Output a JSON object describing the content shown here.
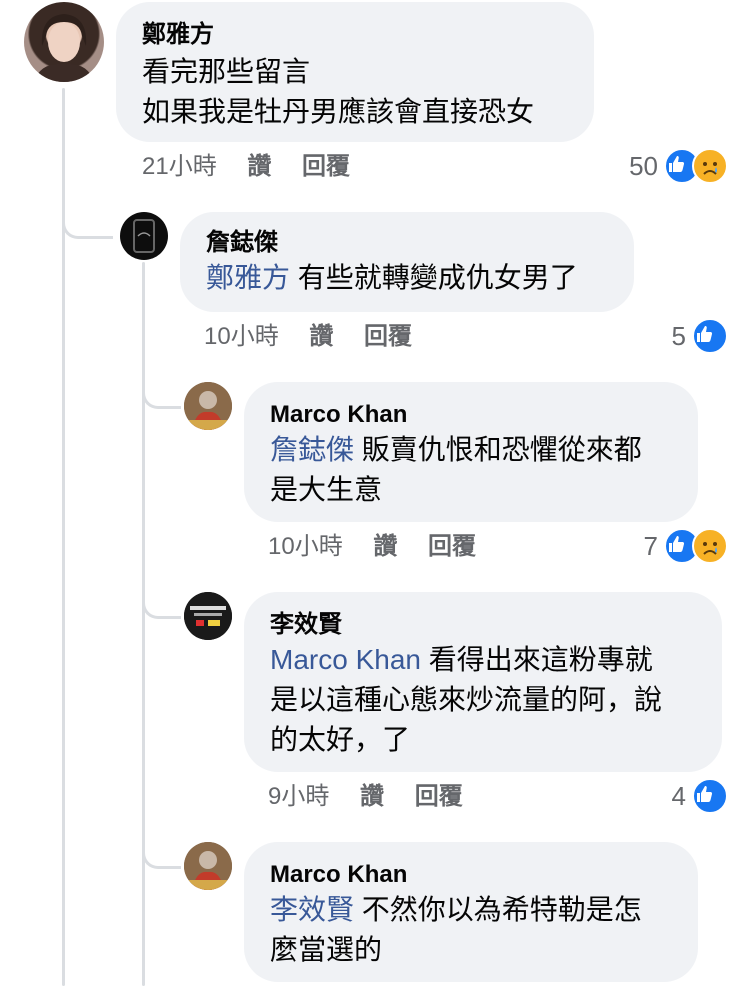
{
  "comments": [
    {
      "author": "鄭雅方",
      "mention": "",
      "line1": "看完那些留言",
      "line2": "如果我是牡丹男應該會直接恐女",
      "line3": "",
      "time": "21小時",
      "like_label": "讚",
      "reply_label": "回覆",
      "reaction_count": "50",
      "reactions": [
        "like-icon",
        "sad-icon"
      ]
    },
    {
      "author": "詹鋕傑",
      "mention": "鄭雅方",
      "line1": "有些就轉變成仇女男了",
      "line2": "",
      "line3": "",
      "time": "10小時",
      "like_label": "讚",
      "reply_label": "回覆",
      "reaction_count": "5",
      "reactions": [
        "like-icon"
      ]
    },
    {
      "author": "Marco Khan",
      "mention": "詹鋕傑",
      "line1": "販賣仇恨和恐懼從來都",
      "line2": "是大生意",
      "line3": "",
      "time": "10小時",
      "like_label": "讚",
      "reply_label": "回覆",
      "reaction_count": "7",
      "reactions": [
        "like-icon",
        "sad-icon"
      ]
    },
    {
      "author": "李效賢",
      "mention": "Marco Khan",
      "line1": "看得出來這粉專就",
      "line2": "是以這種心態來炒流量的阿，說",
      "line3": "的太好，了",
      "time": "9小時",
      "like_label": "讚",
      "reply_label": "回覆",
      "reaction_count": "4",
      "reactions": [
        "like-icon"
      ]
    },
    {
      "author": "Marco Khan",
      "mention": "李效賢",
      "line1": "不然你以為希特勒是怎",
      "line2": "麼當選的",
      "line3": "",
      "time": "",
      "like_label": "",
      "reply_label": "",
      "reaction_count": "",
      "reactions": []
    }
  ],
  "colors": {
    "mention": "#385898",
    "bubble": "#f0f2f5",
    "like": "#1877f2",
    "sad": "#f7b125",
    "meta": "#65676b"
  }
}
